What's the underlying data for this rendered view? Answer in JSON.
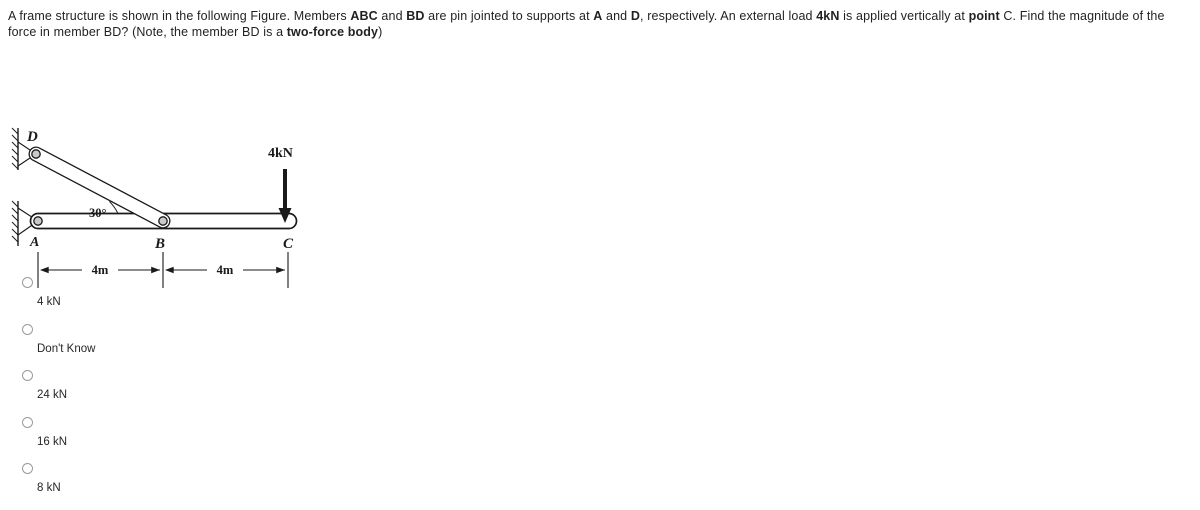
{
  "question": {
    "text_segments": [
      {
        "t": "A frame structure is shown in the following Figure. Members ",
        "b": false
      },
      {
        "t": "ABC",
        "b": true
      },
      {
        "t": " and ",
        "b": false
      },
      {
        "t": "BD",
        "b": true
      },
      {
        "t": " are pin jointed to supports at ",
        "b": false
      },
      {
        "t": "A",
        "b": true
      },
      {
        "t": " and ",
        "b": false
      },
      {
        "t": "D",
        "b": true
      },
      {
        "t": ", respectively. An external load ",
        "b": false
      },
      {
        "t": "4kN",
        "b": true
      },
      {
        "t": " is applied vertically at ",
        "b": false
      },
      {
        "t": "point",
        "b": true
      },
      {
        "t": " ",
        "b": false
      },
      {
        "t": "C",
        "b": false
      },
      {
        "t": ". Find the magnitude of the force in member BD? (Note, the member BD is a ",
        "b": false
      },
      {
        "t": "two-force body",
        "b": true
      },
      {
        "t": ")",
        "b": false
      }
    ],
    "plain": "A frame structure is shown in the following Figure. Members ABC and BD are pin jointed to supports at A and D, respectively. An external load 4kN is applied vertically at point C. Find the magnitude of the force in member BD? (Note, the member BD is a two-force body)"
  },
  "figure": {
    "joint_labels": {
      "a": "A",
      "b": "B",
      "c": "C",
      "d": "D"
    },
    "load_label": "4kN",
    "angle_label": "30°",
    "dimension_left": "4m",
    "dimension_right": "4m",
    "colors": {
      "line": "#1a1a1a",
      "pin_fill": "#c9c9c9",
      "member_fill": "#ffffff",
      "hatch": "#1a1a1a"
    }
  },
  "options": [
    {
      "label": "4 kN",
      "selected": false
    },
    {
      "label": "Don't Know",
      "selected": false
    },
    {
      "label": "24 kN",
      "selected": false
    },
    {
      "label": "16 kN",
      "selected": false
    },
    {
      "label": "8 kN",
      "selected": false
    }
  ]
}
